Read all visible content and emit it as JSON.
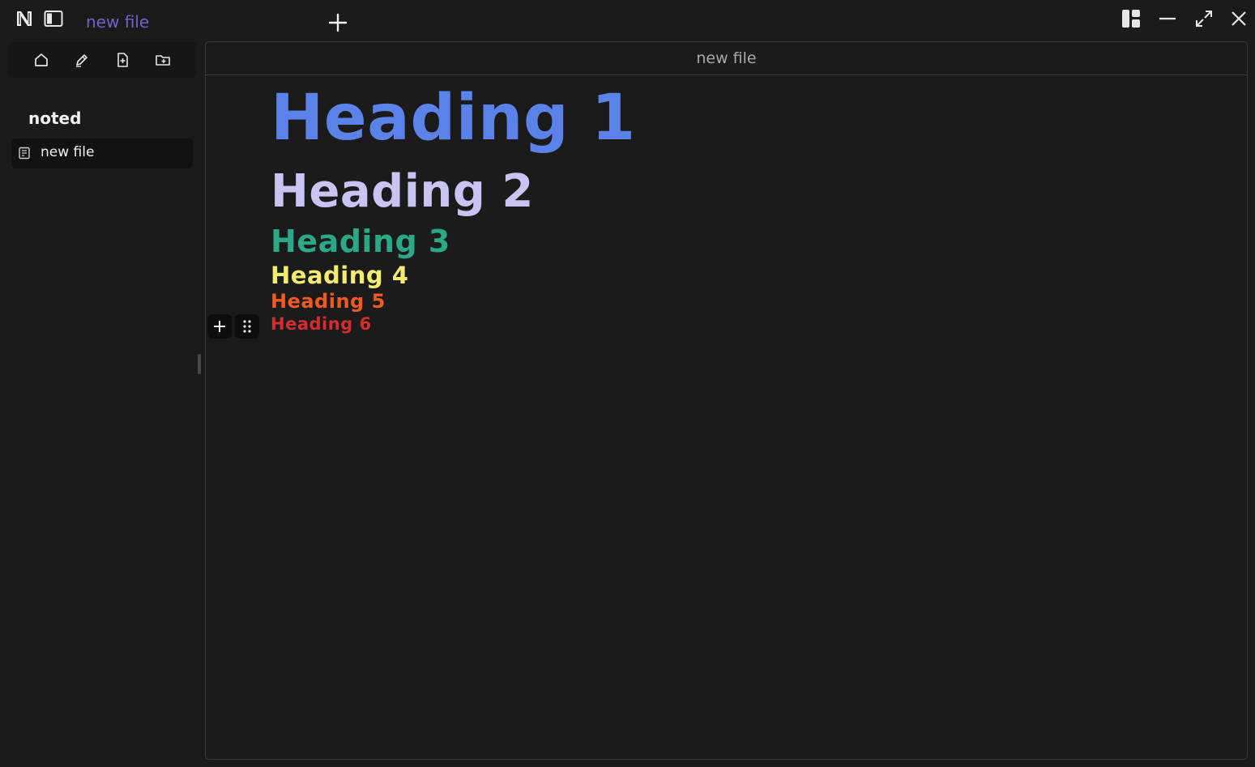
{
  "app": {
    "logo_icon": "n-logo-icon",
    "active_tab": "new file",
    "tab_color": "#6d63c9"
  },
  "sidebar": {
    "workspace": "noted",
    "files": [
      {
        "label": "new file",
        "icon": "file-text-icon"
      }
    ],
    "tools": [
      "home-icon",
      "edit-pen-icon",
      "new-file-icon",
      "new-folder-icon"
    ]
  },
  "editor": {
    "title": "new file",
    "headings": [
      {
        "level": 1,
        "text": "Heading 1",
        "color": "#5b82e8"
      },
      {
        "level": 2,
        "text": "Heading 2",
        "color": "#c9c5f3"
      },
      {
        "level": 3,
        "text": "Heading 3",
        "color": "#2aa887"
      },
      {
        "level": 4,
        "text": "Heading 4",
        "color": "#f3ec70"
      },
      {
        "level": 5,
        "text": "Heading 5",
        "color": "#f05a22"
      },
      {
        "level": 6,
        "text": "Heading 6",
        "color": "#d42d2d"
      }
    ]
  },
  "colors": {
    "background": "#1b1b1b",
    "border": "#3a3a3a"
  }
}
